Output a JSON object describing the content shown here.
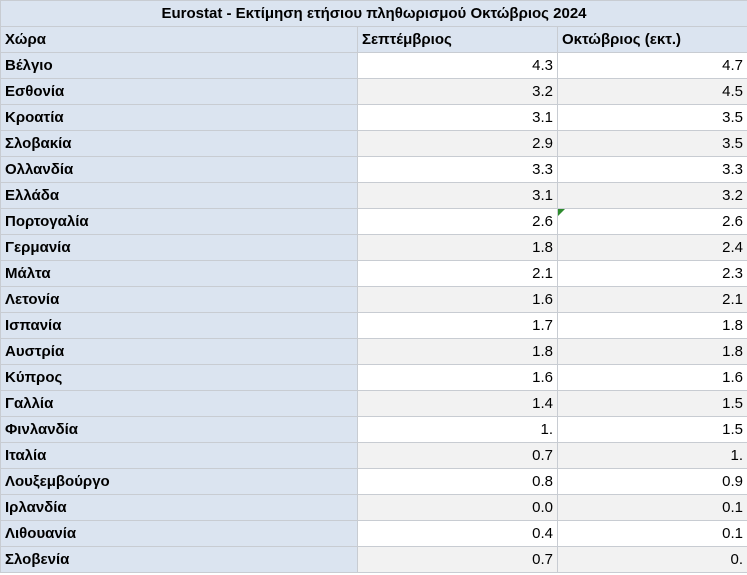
{
  "chart_data": {
    "type": "table",
    "title": "Eurostat - Εκτίμηση ετήσιου πληθωρισμού Οκτώβριος 2024",
    "columns": [
      "Χώρα",
      "Σεπτέμβριος",
      "Οκτώβριος (εκτ.)"
    ],
    "rows": [
      {
        "country": "Βέλγιο",
        "sep": "4.3",
        "oct": "4.7"
      },
      {
        "country": "Εσθονία",
        "sep": "3.2",
        "oct": "4.5"
      },
      {
        "country": "Κροατία",
        "sep": "3.1",
        "oct": "3.5"
      },
      {
        "country": "Σλοβακία",
        "sep": "2.9",
        "oct": "3.5"
      },
      {
        "country": "Ολλανδία",
        "sep": "3.3",
        "oct": "3.3"
      },
      {
        "country": "Ελλάδα",
        "sep": "3.1",
        "oct": "3.2"
      },
      {
        "country": "Πορτογαλία",
        "sep": "2.6",
        "oct": "2.6"
      },
      {
        "country": "Γερμανία",
        "sep": "1.8",
        "oct": "2.4"
      },
      {
        "country": "Μάλτα",
        "sep": "2.1",
        "oct": "2.3"
      },
      {
        "country": "Λετονία",
        "sep": "1.6",
        "oct": "2.1"
      },
      {
        "country": "Ισπανία",
        "sep": "1.7",
        "oct": "1.8"
      },
      {
        "country": "Αυστρία",
        "sep": "1.8",
        "oct": "1.8"
      },
      {
        "country": "Κύπρος",
        "sep": "1.6",
        "oct": "1.6"
      },
      {
        "country": "Γαλλία",
        "sep": "1.4",
        "oct": "1.5"
      },
      {
        "country": "Φινλανδία",
        "sep": "1.",
        "oct": "1.5"
      },
      {
        "country": "Ιταλία",
        "sep": "0.7",
        "oct": "1."
      },
      {
        "country": "Λουξεμβούργο",
        "sep": "0.8",
        "oct": "0.9"
      },
      {
        "country": "Ιρλανδία",
        "sep": "0.0",
        "oct": "0.1"
      },
      {
        "country": "Λιθουανία",
        "sep": "0.4",
        "oct": "0.1"
      },
      {
        "country": "Σλοβενία",
        "sep": "0.7",
        "oct": "0."
      }
    ]
  },
  "flag_color": "#2e8b2e"
}
